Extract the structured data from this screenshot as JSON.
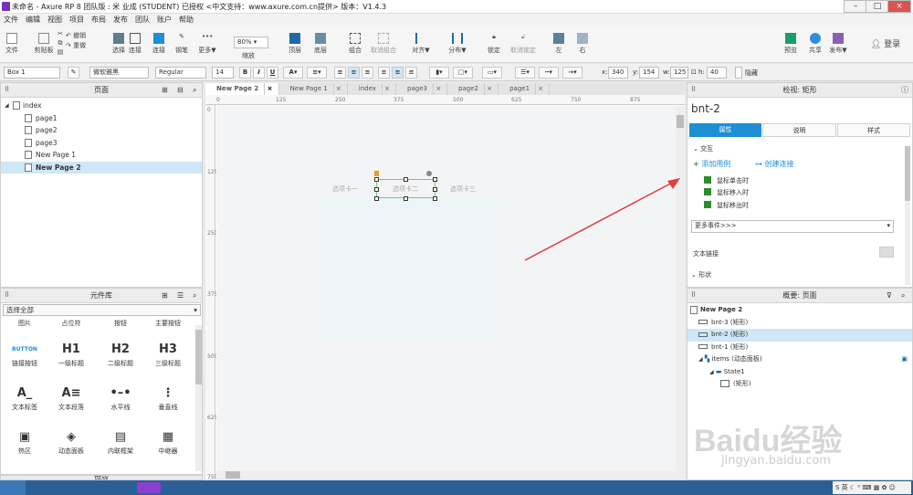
{
  "title": "未命名 - Axure RP 8 团队版 : 米 业成 (STUDENT) 已授权   <中文支持：www.axure.com.cn提供> 版本：V1.4.3",
  "menu": [
    "文件",
    "编辑",
    "视图",
    "项目",
    "布局",
    "发布",
    "团队",
    "账户",
    "帮助"
  ],
  "toolbar": {
    "file": "文件",
    "clipboard": "剪贴板",
    "cut": "剪切",
    "copy": "复制",
    "paste": "粘贴",
    "undo": "撤销",
    "redo": "重做",
    "select": "选择",
    "connect": "连接",
    "pen": "钢笔",
    "more": "更多▼",
    "zoom_value": "80%",
    "zoom": "缩放",
    "top": "顶层",
    "bottom": "底层",
    "group": "组合",
    "ungroup": "取消组合",
    "align": "对齐▼",
    "distribute": "分布▼",
    "lock": "锁定",
    "unlock": "取消锁定",
    "left": "左",
    "right": "右",
    "preview": "预览",
    "share": "共享",
    "publish": "发布▼",
    "login": "登录"
  },
  "format": {
    "style": "Box 1",
    "font": "微软雅黑",
    "weight": "Regular",
    "size": "14",
    "x_label": "x:",
    "x": "340",
    "y_label": "y:",
    "y": "154",
    "w_label": "w:",
    "w": "125",
    "h_label": "h:",
    "h": "40",
    "hidden": "隐藏"
  },
  "pages_panel": {
    "title": "页面",
    "root": "index",
    "items": [
      "page1",
      "page2",
      "page3",
      "New Page 1",
      "New Page 2"
    ]
  },
  "library": {
    "title": "元件库",
    "select": "选择全部",
    "row0": [
      "图片",
      "占位符",
      "按钮",
      "主要按钮"
    ],
    "items": [
      {
        "g": "BUTTON",
        "label": "链接按钮"
      },
      {
        "g": "H1",
        "label": "一级标题"
      },
      {
        "g": "H2",
        "label": "二级标题"
      },
      {
        "g": "H3",
        "label": "三级标题"
      },
      {
        "g": "A_",
        "label": "文本标签"
      },
      {
        "g": "A≡",
        "label": "文本段落"
      },
      {
        "g": "•–•",
        "label": "水平线"
      },
      {
        "g": "⋮",
        "label": "垂直线"
      },
      {
        "g": "▣",
        "label": "热区"
      },
      {
        "g": "◈",
        "label": "动态面板"
      },
      {
        "g": "▤",
        "label": "内联框架"
      },
      {
        "g": "▦",
        "label": "中继器"
      }
    ]
  },
  "masters": "母版",
  "doc_tabs": [
    "New Page 2",
    "New Page 1",
    "index",
    "page3",
    "page2",
    "page1"
  ],
  "ruler_h": [
    "0",
    "125",
    "250",
    "375",
    "500",
    "625",
    "750",
    "875"
  ],
  "ruler_v": [
    "0",
    "125",
    "250",
    "375",
    "500",
    "625",
    "750"
  ],
  "canvas_tabs": [
    "选项卡一",
    "选项卡二",
    "选项卡三"
  ],
  "inspector": {
    "title": "检视: 矩形",
    "name": "bnt-2",
    "tabs": [
      "属性",
      "说明",
      "样式"
    ],
    "section": "交互",
    "add_case": "添加用例",
    "create_link": "创建连接",
    "events": [
      "鼠标单击时",
      "鼠标移入时",
      "鼠标移出时"
    ],
    "more_events": "更多事件>>>",
    "text_link": "文本链接",
    "shape": "形状"
  },
  "outline": {
    "title": "概要: 页面",
    "page": "New Page 2",
    "items": [
      "bnt-3 (矩形)",
      "bnt-2 (矩形)",
      "bnt-1 (矩形)",
      "items (动态面板)",
      "State1",
      "(矩形)"
    ]
  },
  "watermark": "Baidu经验",
  "watermark_sub": "jingyan.baidu.com",
  "colors": {
    "accent": "#1e8fd4",
    "selection": "#cfe7f7",
    "arrow": "#e23c3c",
    "panel_fill": "#eef5f8"
  }
}
